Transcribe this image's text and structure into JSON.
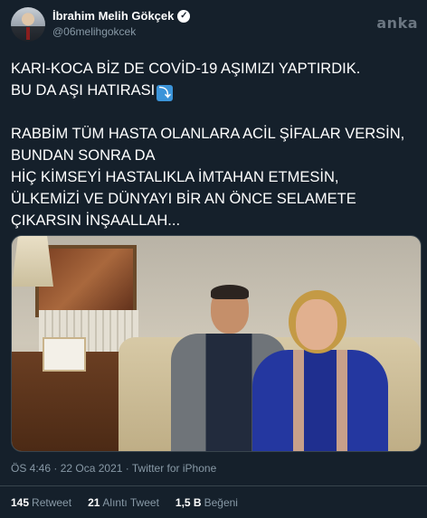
{
  "user": {
    "name": "İbrahim Melih Gökçek",
    "handle": "@06melihgokcek",
    "verified_icon": "verified-badge-icon"
  },
  "watermark": "anka",
  "tweet": {
    "line1": "KARI-KOCA BİZ DE COVİD-19 AŞIMIZI YAPTIRDIK.",
    "line2": "BU DA AŞI HATIRASI",
    "arrow_icon": "⤵",
    "line3": "RABBİM TÜM HASTA OLANLARA ACİL ŞİFALAR VERSİN,",
    "line4": "BUNDAN SONRA DA",
    "line5": "HİÇ KİMSEYİ HASTALIKLA İMTAHAN ETMESİN,",
    "line6": "ÜLKEMİZİ VE DÜNYAYI BİR AN ÖNCE SELAMETE",
    "line7": "ÇIKARSIN İNŞAALLAH..."
  },
  "meta": {
    "time": "ÖS 4:46",
    "sep1": " · ",
    "date": "22 Oca 2021",
    "sep2": " · ",
    "source": "Twitter for iPhone"
  },
  "stats": {
    "retweets_count": "145",
    "retweets_label": "Retweet",
    "quotes_count": "21",
    "quotes_label": "Alıntı Tweet",
    "likes_count": "1,5 B",
    "likes_label": "Beğeni"
  }
}
